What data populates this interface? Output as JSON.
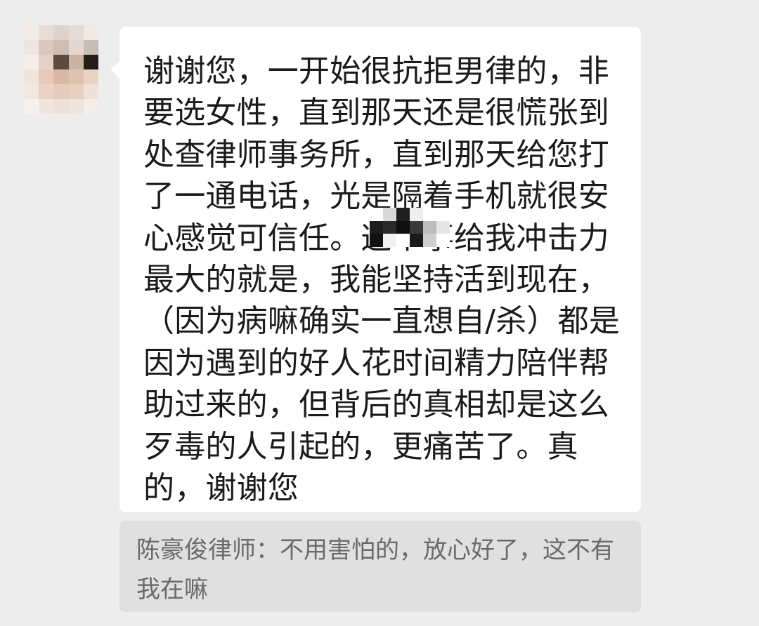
{
  "chat": {
    "sender_avatar": {
      "icon": "pixelated-avatar-icon",
      "mosaic_colors": [
        [
          "#f2ece8",
          "#e8ddd6",
          "#ddd3cd",
          "#e6dcd5",
          "#f0e9e4"
        ],
        [
          "#efe6e0",
          "#d9c8bd",
          "#cdbdb3",
          "#e2d7d1",
          "#c9beb7"
        ],
        [
          "#f4ede8",
          "#e3d2c5",
          "#5a4a3f",
          "#c9b3a2",
          "#241d1a"
        ],
        [
          "#f1e4dc",
          "#e6c9b8",
          "#d9b8a5",
          "#e0c2b0",
          "#ead2c4"
        ],
        [
          "#f3e7df",
          "#ead3c4",
          "#e5cbbb",
          "#e8d0c1",
          "#f0e1d8"
        ],
        [
          "#f6f1ee",
          "#f1e6df",
          "#ede0d8",
          "#f0e5de",
          "#f4ede9"
        ]
      ]
    },
    "message": {
      "text": "谢谢您，一开始很抗拒男律的，非要选女性，直到那天还是很慌张到处查律师事务所，直到那天给您打了一通电话，光是隔着手机就很安心感觉可信任。这个事给我冲击力最大的就是，我能坚持活到现在，（因为病嘛确实一直想自/杀）都是因为遇到的好人花时间精力陪伴帮助过来的，但背后的真相却是这么歹毒的人引起的，更痛苦了。真的，谢谢您",
      "redaction_colors": [
        [
          "#ffffff",
          "#d9d9d9",
          "#1e1e1e",
          "#efefef",
          "#ffffff",
          "#ffffff"
        ],
        [
          "#1c1c1c",
          "#2a2a2a",
          "#0f0f0f",
          "#3a3a3a",
          "#bdbdbd",
          "#e6e6e6"
        ],
        [
          "#111111",
          "#f2f2f2",
          "#ffffff",
          "#1a1a1a",
          "#cfcfcf",
          "#ffffff"
        ]
      ]
    },
    "quoted_reply": {
      "text": "陈豪俊律师：不用害怕的，放心好了，这不有我在嘛"
    }
  }
}
